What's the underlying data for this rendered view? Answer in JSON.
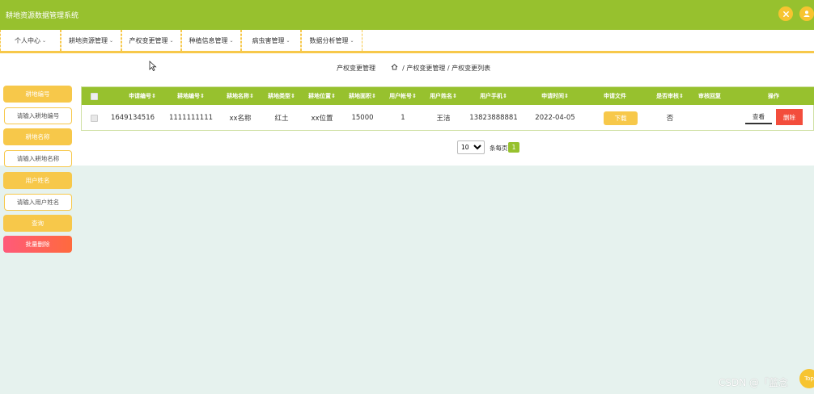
{
  "app": {
    "title": "耕地资源数据管理系统"
  },
  "header": {
    "close_icon": "close-icon",
    "user_icon": "user-icon"
  },
  "nav": {
    "items": [
      {
        "label": "个人中心",
        "caret": "⌄"
      },
      {
        "label": "耕地资源管理",
        "caret": "⌄"
      },
      {
        "label": "产权变更管理",
        "caret": "⌄"
      },
      {
        "label": "种植信息管理",
        "caret": "⌄"
      },
      {
        "label": "病虫害管理",
        "caret": "⌄"
      },
      {
        "label": "数据分析管理",
        "caret": "⌄"
      }
    ]
  },
  "breadcrumb": {
    "page_title": "产权变更管理",
    "path": "/ 产权变更管理 / 产权变更列表"
  },
  "sidebar": {
    "fields": [
      {
        "label": "耕地编号",
        "placeholder": "请输入耕地编号"
      },
      {
        "label": "耕地名称",
        "placeholder": "请输入耕地名称"
      },
      {
        "label": "用户姓名",
        "placeholder": "请输入用户姓名"
      }
    ],
    "search_label": "查询",
    "batch_delete_label": "批量删除"
  },
  "table": {
    "columns": [
      "申请编号",
      "耕地编号",
      "耕地名称",
      "耕地类型",
      "耕地位置",
      "耕地面积",
      "用户帐号",
      "用户姓名",
      "用户手机",
      "申请时间",
      "申请文件",
      "是否审核",
      "审核回复",
      "操作"
    ],
    "sortable": [
      true,
      true,
      true,
      true,
      true,
      true,
      true,
      true,
      true,
      true,
      false,
      true,
      false,
      false
    ],
    "sort_indicator": "⇕",
    "rows": [
      {
        "application_no": "1649134516",
        "land_no": "1111111111",
        "land_name": "xx名称",
        "land_type": "红土",
        "land_location": "xx位置",
        "land_area": "15000",
        "user_account": "1",
        "user_name": "王洁",
        "user_phone": "13823888881",
        "apply_time": "2022-04-05",
        "download_label": "下载",
        "reviewed": "否",
        "review_reply": "",
        "view_label": "查看",
        "delete_label": "删除"
      }
    ]
  },
  "pagination": {
    "page_size": "10",
    "page_size_options": [
      "10"
    ],
    "per_page_label": "条每页",
    "current_page": "1"
  },
  "watermark": "CSDN @「蓝念",
  "top_label": "Top",
  "colors": {
    "header": "#97c12e",
    "accent": "#f7c84a",
    "danger": "#f34d3c",
    "background": "#e6f2ee"
  }
}
